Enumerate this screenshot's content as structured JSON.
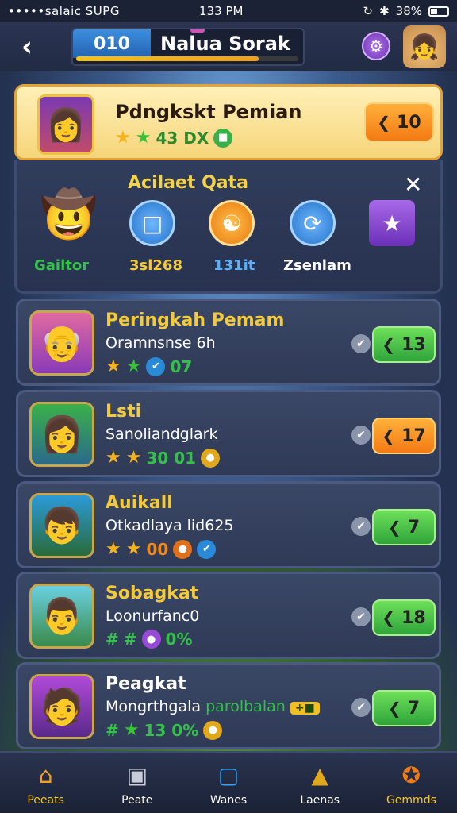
{
  "status_bar": {
    "carrier": "•••••salaic SUPG",
    "time": "133 PM",
    "battery": "38%"
  },
  "header": {
    "level": "010",
    "title": "Nalua Sorak",
    "progress": 0.82
  },
  "player_rank": {
    "title": "Pdngkskt Pemian",
    "stats_text": "43 DX",
    "rank_value": "10"
  },
  "achievements": {
    "title": "Acilaet Qata",
    "items": [
      {
        "label": "Gailtor",
        "color": "#35c04a"
      },
      {
        "label": "3sl268",
        "color": "#f4c93a"
      },
      {
        "label": "131it",
        "color": "#5ab0ff"
      },
      {
        "label": "Zsenlam",
        "color": "#ffffff"
      }
    ]
  },
  "rows": [
    {
      "name": "Peringkah Pemam",
      "sub": "Oramnsnse 6h",
      "stat": "07",
      "value": "13",
      "pill": "green"
    },
    {
      "name": "Lsti",
      "sub": "Sanoliandglark",
      "stat": "30  01",
      "value": "17",
      "pill": "orange"
    },
    {
      "name": "Auikall",
      "sub": "Otkadlaya lid625",
      "stat": "00",
      "value": "7",
      "pill": "green"
    },
    {
      "name": "Sobagkat",
      "sub": "Loonurfanc0",
      "stat": "0%",
      "value": "18",
      "pill": "green"
    },
    {
      "name": "Peagkat",
      "sub": "Mongrthgala",
      "sub2": "parolbalan",
      "stat": "13  0%",
      "value": "7",
      "pill": "green"
    }
  ],
  "nav": [
    {
      "label": "Peeats",
      "icon": "home-icon"
    },
    {
      "label": "Peate",
      "icon": "box-icon"
    },
    {
      "label": "Wanes",
      "icon": "card-icon"
    },
    {
      "label": "Laenas",
      "icon": "trophy-icon"
    },
    {
      "label": "Gemmds",
      "icon": "badge-icon"
    }
  ]
}
